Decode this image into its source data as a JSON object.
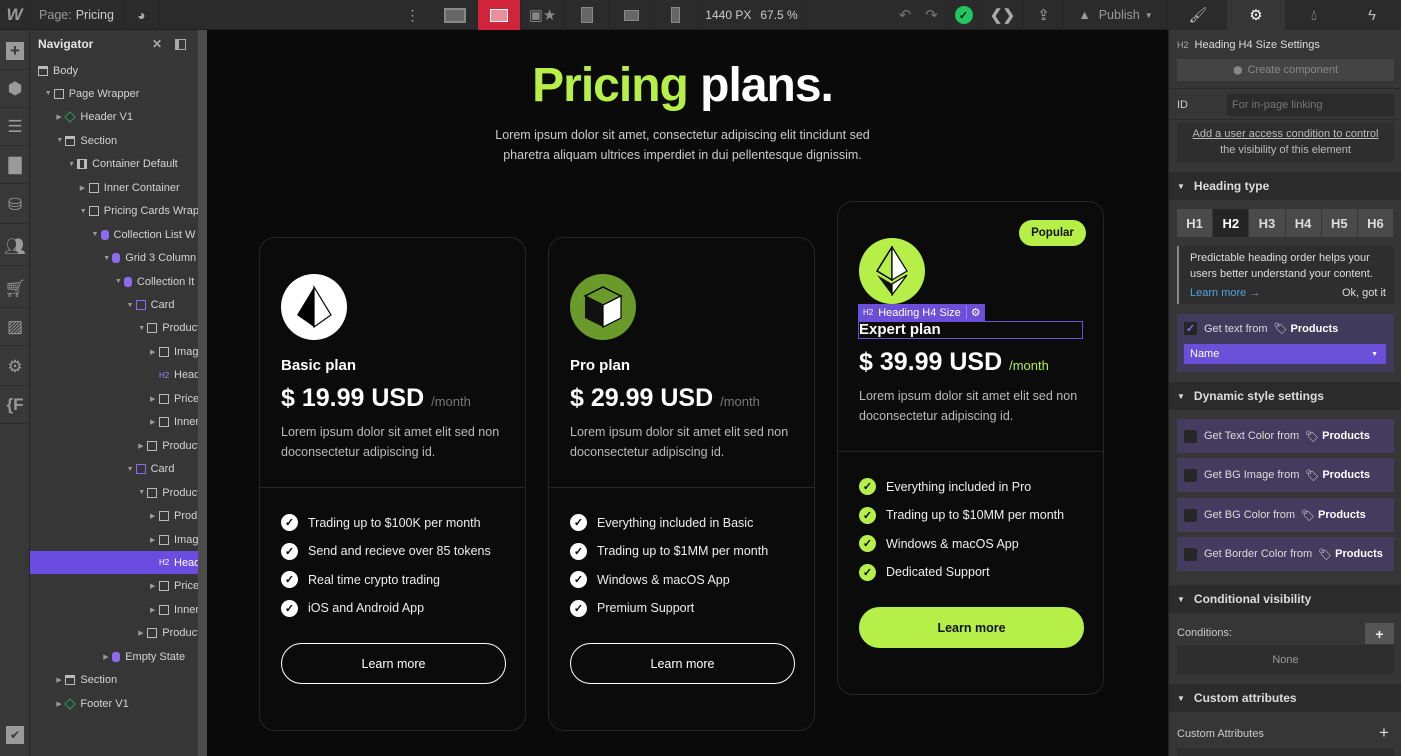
{
  "topbar": {
    "logo": "W",
    "page_label": "Page:",
    "page_name": "Pricing",
    "width": "1440 PX",
    "zoom": "67.5 %",
    "publish": "Publish",
    "active_breakpoint": "desktop",
    "accent": "#d0243b"
  },
  "rail": {
    "icons": [
      "plus-icon",
      "cube-icon",
      "navigator-icon",
      "pages-icon",
      "cms-icon",
      "users-icon",
      "ecommerce-icon",
      "assets-icon",
      "settings-icon",
      "finsweet-icon"
    ],
    "finsweet_label": "{F"
  },
  "navigator": {
    "title": "Navigator",
    "items": [
      {
        "label": "Body",
        "level": 0,
        "icon": "body"
      },
      {
        "label": "Page Wrapper",
        "level": 1,
        "icon": "box",
        "caret": "open"
      },
      {
        "label": "Header V1",
        "level": 2,
        "icon": "component",
        "caret": "closed"
      },
      {
        "label": "Section",
        "level": 2,
        "icon": "section",
        "caret": "open"
      },
      {
        "label": "Container Default",
        "level": 3,
        "icon": "container",
        "caret": "open"
      },
      {
        "label": "Inner Container",
        "level": 4,
        "icon": "box",
        "caret": "closed"
      },
      {
        "label": "Pricing Cards Wrap",
        "level": 4,
        "icon": "box",
        "caret": "open"
      },
      {
        "label": "Collection List W",
        "level": 5,
        "icon": "collection",
        "caret": "open"
      },
      {
        "label": "Grid 3 Column",
        "level": 6,
        "icon": "collection-list",
        "caret": "open"
      },
      {
        "label": "Collection It",
        "level": 7,
        "icon": "collection-list",
        "caret": "open"
      },
      {
        "label": "Card",
        "level": 8,
        "icon": "card",
        "caret": "open"
      },
      {
        "label": "Product",
        "level": 9,
        "icon": "box",
        "caret": "open"
      },
      {
        "label": "Image",
        "level": 10,
        "icon": "box",
        "caret": "closed"
      },
      {
        "label": "Head",
        "level": 10,
        "icon": "h2"
      },
      {
        "label": "Price",
        "level": 10,
        "icon": "box",
        "caret": "closed"
      },
      {
        "label": "Inner",
        "level": 10,
        "icon": "box",
        "caret": "closed"
      },
      {
        "label": "Product",
        "level": 9,
        "icon": "box",
        "caret": "closed"
      },
      {
        "label": "Card",
        "level": 8,
        "icon": "card",
        "caret": "open"
      },
      {
        "label": "Product",
        "level": 9,
        "icon": "box",
        "caret": "open"
      },
      {
        "label": "Produ",
        "level": 10,
        "icon": "box",
        "caret": "closed"
      },
      {
        "label": "Image",
        "level": 10,
        "icon": "box",
        "caret": "closed"
      },
      {
        "label": "Head",
        "level": 10,
        "icon": "h2",
        "selected": true
      },
      {
        "label": "Price",
        "level": 10,
        "icon": "box",
        "caret": "closed"
      },
      {
        "label": "Inner",
        "level": 10,
        "icon": "box",
        "caret": "closed"
      },
      {
        "label": "Product",
        "level": 9,
        "icon": "box",
        "caret": "closed"
      },
      {
        "label": "Empty State",
        "level": 6,
        "icon": "collection-list",
        "caret": "closed"
      },
      {
        "label": "Section",
        "level": 2,
        "icon": "section",
        "caret": "closed"
      },
      {
        "label": "Footer V1",
        "level": 2,
        "icon": "component",
        "caret": "closed"
      }
    ]
  },
  "canvas": {
    "title_accent": "Pricing",
    "title_rest": "plans.",
    "subtitle_1": "Lorem ipsum dolor sit amet, consectetur adipiscing elit tincidunt sed",
    "subtitle_2": "pharetra aliquam ultrices imperdiet in dui pellentesque dignissim.",
    "accent": "#b5ef47",
    "selection_label": "Heading H4 Size",
    "selection_tag": "H2",
    "cards": [
      {
        "name": "Basic plan",
        "price": "$ 19.99 USD",
        "period": "/month",
        "desc_1": "Lorem ipsum dolor sit amet elit sed non",
        "desc_2": "doconsectetur adipiscing id.",
        "features": [
          "Trading up to $100K per month",
          "Send and recieve over 85 tokens",
          "Real time crypto trading",
          "iOS and Android App"
        ],
        "button": "Learn more",
        "icon": "pyramid-icon",
        "icon_color": "#ffffff"
      },
      {
        "name": "Pro plan",
        "price": "$ 29.99 USD",
        "period": "/month",
        "desc_1": "Lorem ipsum dolor sit amet elit sed non",
        "desc_2": "doconsectetur adipiscing id.",
        "features": [
          "Everything included in Basic",
          "Trading up to $1MM per month",
          "Windows & macOS App",
          "Premium Support"
        ],
        "button": "Learn more",
        "icon": "cube-icon",
        "icon_color": "#6a9a2a"
      },
      {
        "name": "Expert plan",
        "price": "$ 39.99 USD",
        "period": "/month",
        "desc_1": "Lorem ipsum dolor sit amet elit sed non",
        "desc_2": "doconsectetur adipiscing id.",
        "features": [
          "Everything included in Pro",
          "Trading up to $10MM per month",
          "Windows & macOS App",
          "Dedicated Support"
        ],
        "button": "Learn more",
        "badge": "Popular",
        "icon": "ethereum-icon",
        "icon_color": "#b5ef47"
      }
    ]
  },
  "panel": {
    "tabs": [
      "brush-icon",
      "gear-icon",
      "drops-icon",
      "bolt-icon"
    ],
    "active_tab": "gear-icon",
    "element_tag": "H2",
    "element_title": "Heading H4 Size Settings",
    "create_component": "Create component",
    "id_label": "ID",
    "id_placeholder": "For in-page linking",
    "access_line_1": "Add a user access condition to control",
    "access_line_2": "the visibility of this element",
    "heading_type": {
      "title": "Heading type",
      "options": [
        "H1",
        "H2",
        "H3",
        "H4",
        "H5",
        "H6"
      ],
      "selected": "H2",
      "tip_1": "Predictable heading order helps your",
      "tip_2": "users better understand your content.",
      "learn_more": "Learn more →",
      "ok": "Ok, got it"
    },
    "get_text": {
      "label": "Get text from",
      "source": "Products",
      "checked": true,
      "field": "Name"
    },
    "dynamic_style": {
      "title": "Dynamic style settings",
      "items": [
        {
          "label": "Get Text Color from",
          "source": "Products"
        },
        {
          "label": "Get BG Image from",
          "source": "Products"
        },
        {
          "label": "Get BG Color from",
          "source": "Products"
        },
        {
          "label": "Get Border Color from",
          "source": "Products"
        }
      ]
    },
    "conditional": {
      "title": "Conditional visibility",
      "conditions_label": "Conditions:",
      "none": "None"
    },
    "custom_attributes": {
      "title": "Custom attributes",
      "label": "Custom Attributes"
    }
  }
}
